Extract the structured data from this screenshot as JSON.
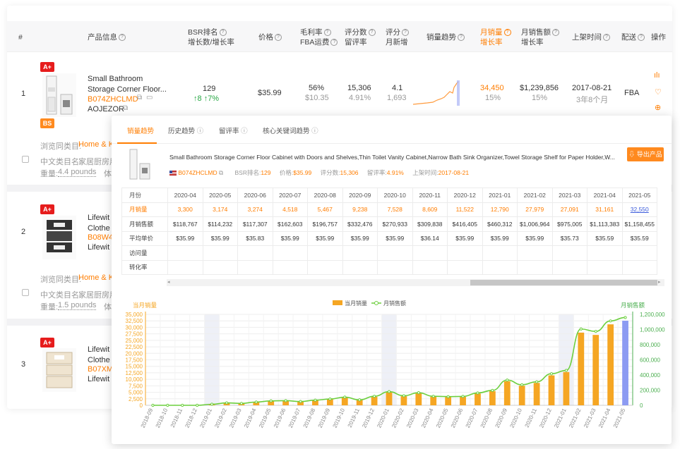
{
  "headers": {
    "idx": "#",
    "product": "产品信息",
    "bsr1": "BSR排名",
    "bsr2": "增长数/增长率",
    "price": "价格",
    "margin1": "毛利率",
    "margin2": "FBA运费",
    "reviews1": "评分数",
    "reviews2": "留评率",
    "rating1": "评分",
    "rating2": "月新增",
    "trend": "销量趋势",
    "msales1": "月销量",
    "msales2": "增长率",
    "mrev1": "月销售额",
    "mrev2": "增长率",
    "launch": "上架时间",
    "ship": "配送",
    "ops": "操作"
  },
  "rows": [
    {
      "index": "1",
      "name1": "Small Bathroom",
      "name2": "Storage Corner Floor...",
      "asin": "B074ZHCLMD",
      "brand": "AOJEZOR",
      "bsr": "129",
      "bsr_delta": "↑8",
      "bsr_rate": "↑7%",
      "price": "$35.99",
      "margin": "56%",
      "fba": "$10.35",
      "reviews": "15,306",
      "review_rate": "4.91%",
      "rating": "4.1",
      "rating_new": "1,693",
      "msales": "34,450",
      "msales_rate": "15%",
      "mrev": "$1,239,856",
      "mrev_rate": "15%",
      "launch": "2017-08-21",
      "launch_age": "3年8个月",
      "ship": "FBA",
      "badges": [
        "A+",
        "BS"
      ],
      "browse_label": "浏览同类目:",
      "browse_val": "Home & K",
      "cn_label": "中文类目名:",
      "cn_val": "家居厨房用",
      "weight_label": "重量:",
      "weight_val": "4.4 pounds",
      "vol": "体"
    },
    {
      "index": "2",
      "name1": "Lifewit",
      "name2": "Clothe",
      "asin": "B08W4",
      "brand": "Lifewit",
      "badges": [
        "A+"
      ],
      "browse_label": "浏览同类目:",
      "browse_val": "Home & K",
      "cn_label": "中文类目名:",
      "cn_val": "家居厨房用",
      "weight_label": "重量:",
      "weight_val": "1.5 pounds",
      "vol": "体"
    },
    {
      "index": "3",
      "name1": "Lifewit",
      "name2": "Clothe",
      "asin": "B07XM",
      "brand": "Lifewit",
      "badges": [
        "A+"
      ]
    }
  ],
  "popup": {
    "tabs": [
      "销量趋势",
      "历史趋势",
      "留评率",
      "核心关键词趋势"
    ],
    "title": "Small Bathroom Storage Corner Floor Cabinet with Doors and Shelves,Thin Toilet Vanity Cabinet,Narrow Bath Sink Organizer,Towel Storage Shelf for Paper Holder,W...",
    "asin": "B074ZHCLMD",
    "meta": [
      {
        "label": "BSR排名:",
        "value": "129"
      },
      {
        "label": "价格:",
        "value": "$35.99"
      },
      {
        "label": "评分数:",
        "value": "15,306"
      },
      {
        "label": "留评率:",
        "value": "4.91%"
      },
      {
        "label": "上架时间:",
        "value": "2017-08-21"
      }
    ],
    "export": "导出产品",
    "table": {
      "month_label": "月份",
      "months": [
        "2020-04",
        "2020-05",
        "2020-06",
        "2020-07",
        "2020-08",
        "2020-09",
        "2020-10",
        "2020-11",
        "2020-12",
        "2021-01",
        "2021-02",
        "2021-03",
        "2021-04",
        "2021-05"
      ],
      "rows": [
        {
          "label": "月销量",
          "values": [
            "3,300",
            "3,174",
            "3,274",
            "4,518",
            "5,467",
            "9,238",
            "7,528",
            "8,609",
            "11,522",
            "12,790",
            "27,979",
            "27,091",
            "31,161",
            "32,550"
          ]
        },
        {
          "label": "月销售额",
          "values": [
            "$118,767",
            "$114,232",
            "$117,307",
            "$162,603",
            "$196,757",
            "$332,476",
            "$270,933",
            "$309,838",
            "$416,405",
            "$460,312",
            "$1,006,964",
            "$975,005",
            "$1,113,383",
            "$1,158,455"
          ]
        },
        {
          "label": "平均单价",
          "values": [
            "$35.99",
            "$35.99",
            "$35.83",
            "$35.99",
            "$35.99",
            "$35.99",
            "$35.99",
            "$36.14",
            "$35.99",
            "$35.99",
            "$35.99",
            "$35.73",
            "$35.59",
            ""
          ]
        },
        {
          "label": "访问量",
          "values": [
            "",
            "",
            "",
            "",
            "",
            "",
            "",
            "",
            "",
            "",
            "",
            "",
            "",
            ""
          ]
        },
        {
          "label": "转化率",
          "values": [
            "",
            "",
            "",
            "",
            "",
            "",
            "",
            "",
            "",
            "",
            "",
            "",
            "",
            ""
          ]
        }
      ]
    }
  },
  "chart_data": {
    "type": "bar",
    "left_axis_label": "当月销量",
    "right_axis_label": "月销售额",
    "legend": [
      "当月销量",
      "月销售额"
    ],
    "categories": [
      "2018-09",
      "2018-10",
      "2018-11",
      "2018-12",
      "2019-01",
      "2019-02",
      "2019-03",
      "2019-04",
      "2019-05",
      "2019-06",
      "2019-07",
      "2019-08",
      "2019-09",
      "2019-10",
      "2019-11",
      "2019-12",
      "2020-01",
      "2020-02",
      "2020-03",
      "2020-04",
      "2020-05",
      "2020-06",
      "2020-07",
      "2020-08",
      "2020-09",
      "2020-10",
      "2020-11",
      "2020-12",
      "2021-01",
      "2021-02",
      "2021-03",
      "2021-04",
      "2021-05"
    ],
    "series": [
      {
        "name": "当月销量",
        "values": [
          0,
          0,
          0,
          0,
          400,
          900,
          700,
          1200,
          1600,
          1700,
          1400,
          1900,
          2300,
          3000,
          2000,
          3300,
          5000,
          3500,
          4600,
          3300,
          3174,
          3274,
          4518,
          5467,
          9238,
          7528,
          8609,
          11522,
          12790,
          27979,
          27091,
          31161,
          32550
        ],
        "color": "#f5a623"
      },
      {
        "name": "月销售额",
        "values": [
          0,
          0,
          0,
          0,
          14000,
          32000,
          25000,
          43000,
          58000,
          61000,
          50000,
          68000,
          83000,
          108000,
          72000,
          119000,
          180000,
          126000,
          166000,
          118767,
          114232,
          117307,
          162603,
          196757,
          332476,
          270933,
          309838,
          416405,
          460312,
          1006964,
          975005,
          1113383,
          1158455
        ],
        "color": "#6ccf3e"
      }
    ],
    "ylim_left": [
      0,
      35000
    ],
    "ylim_right": [
      0,
      1200000
    ],
    "left_ticks": [
      "0",
      "2,500",
      "5,000",
      "7,500",
      "10,000",
      "12,500",
      "15,000",
      "17,500",
      "20,000",
      "22,500",
      "25,000",
      "27,500",
      "30,000",
      "32,500",
      "35,000"
    ],
    "right_ticks": [
      "0",
      "200,000",
      "400,000",
      "600,000",
      "800,000",
      "1,000,000",
      "1,200,000"
    ]
  }
}
